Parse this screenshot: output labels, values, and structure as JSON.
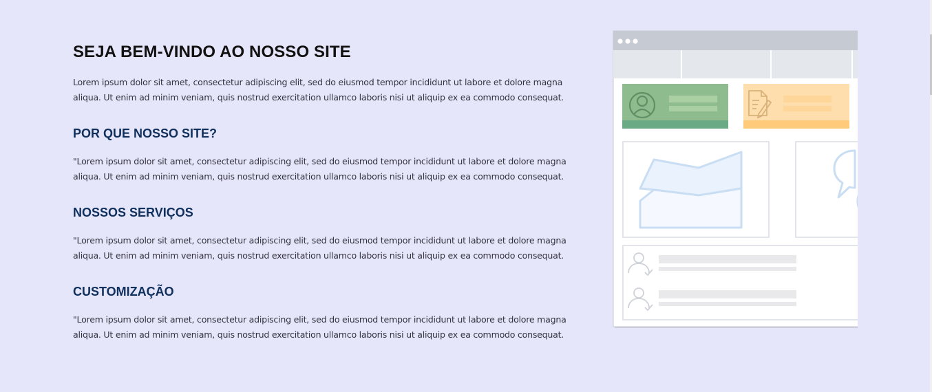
{
  "hero": {
    "title": "SEJA BEM-VINDO AO NOSSO SITE",
    "text": "Lorem ipsum dolor sit amet, consectetur adipiscing elit, sed do eiusmod tempor incididunt ut labore et dolore magna aliqua. Ut enim ad minim veniam, quis nostrud exercitation ullamco laboris nisi ut aliquip ex ea commodo consequat."
  },
  "sections": [
    {
      "title": "POR QUE NOSSO SITE?",
      "text": "\"Lorem ipsum dolor sit amet, consectetur adipiscing elit, sed do eiusmod tempor incididunt ut labore et dolore magna aliqua. Ut enim ad minim veniam, quis nostrud exercitation ullamco laboris nisi ut aliquip ex ea commodo consequat."
    },
    {
      "title": "NOSSOS SERVIÇOS",
      "text": "\"Lorem ipsum dolor sit amet, consectetur adipiscing elit, sed do eiusmod tempor incididunt ut labore et dolore magna aliqua. Ut enim ad minim veniam, quis nostrud exercitation ullamco laboris nisi ut aliquip ex ea commodo consequat."
    },
    {
      "title": "CUSTOMIZAÇÃO",
      "text": "\"Lorem ipsum dolor sit amet, consectetur adipiscing elit, sed do eiusmod tempor incididunt ut labore et dolore magna aliqua. Ut enim ad minim veniam, quis nostrud exercitation ullamco laboris nisi ut aliquip ex ea commodo consequat."
    }
  ],
  "illustration": {
    "name": "dashboard-illustration",
    "colors": {
      "page_background": "#e6e6fa",
      "card_green": "#8fbc8f",
      "card_green_bar": "#6aaa84",
      "card_orange": "#ffdead",
      "card_orange_bar": "#ffca7a",
      "chart_stroke": "#c9ddf3"
    }
  }
}
